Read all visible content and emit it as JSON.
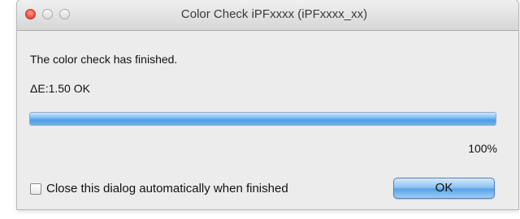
{
  "window": {
    "title": "Color Check iPFxxxx (iPFxxxx_xx)"
  },
  "dialog": {
    "message": "The color check has finished.",
    "delta_result": "ΔE:1.50 OK",
    "progress": {
      "value_percent": 100,
      "label": "100%"
    },
    "auto_close_checkbox": {
      "label": "Close this dialog automatically when finished",
      "checked": false
    },
    "ok_button_label": "OK"
  },
  "colors": {
    "progress_fill": "#5aa3e8",
    "close_button": "#f25b4b"
  }
}
